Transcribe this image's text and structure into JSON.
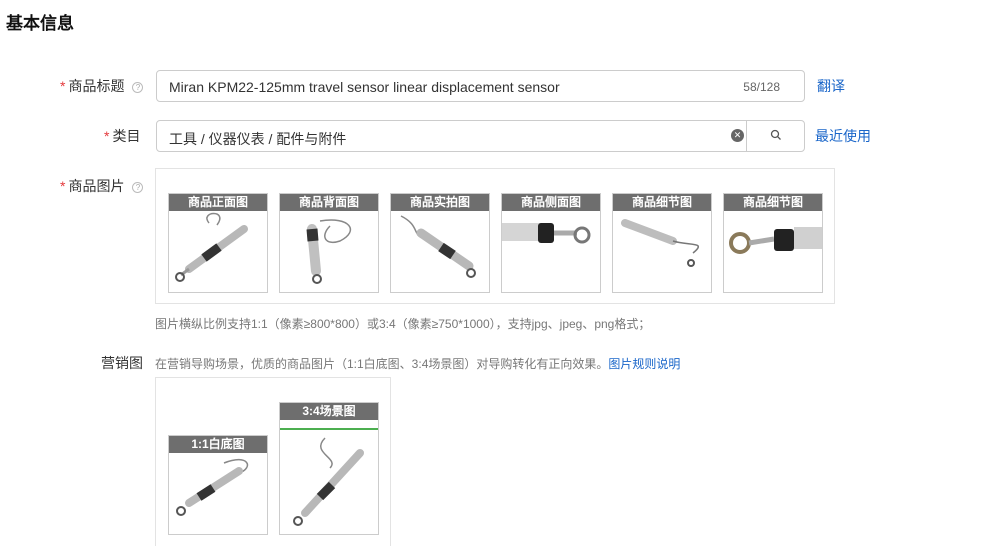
{
  "section": {
    "title": "基本信息"
  },
  "title_field": {
    "required_mark": "*",
    "label": "商品标题",
    "value": "Miran KPM22-125mm travel sensor linear displacement sensor",
    "counter": "58/128",
    "translate_link": "翻译"
  },
  "category_field": {
    "required_mark": "*",
    "label": "类目",
    "value": "工具 / 仪器仪表 / 配件与附件",
    "recent_link": "最近使用"
  },
  "images_field": {
    "required_mark": "*",
    "label": "商品图片",
    "thumbs": [
      {
        "caption": "商品正面图"
      },
      {
        "caption": "商品背面图"
      },
      {
        "caption": "商品实拍图"
      },
      {
        "caption": "商品侧面图"
      },
      {
        "caption": "商品细节图"
      },
      {
        "caption": "商品细节图"
      }
    ],
    "hint": "图片横纵比例支持1:1（像素≥800*800）或3:4（像素≥750*1000），支持jpg、jpeg、png格式；"
  },
  "marketing_field": {
    "label": "营销图",
    "hint": "在营销导购场景，优质的商品图片（1:1白底图、3:4场景图）对导购转化有正向效果。",
    "rules_link": "图片规则说明",
    "thumbs": [
      {
        "caption": "1:1白底图"
      },
      {
        "caption": "3:4场景图"
      }
    ]
  }
}
